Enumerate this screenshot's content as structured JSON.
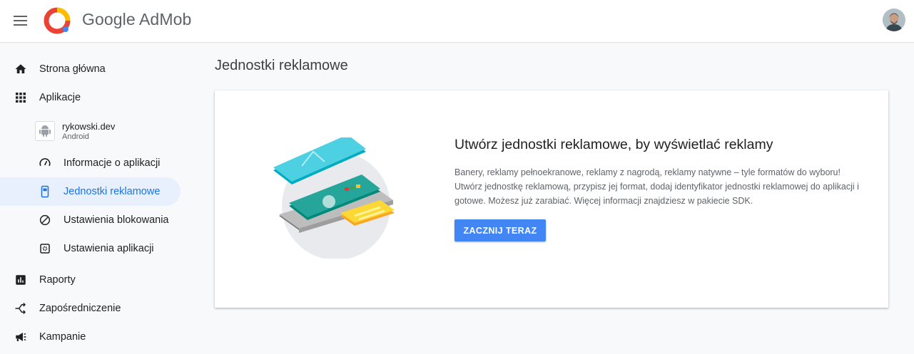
{
  "header": {
    "brand": "Google AdMob",
    "menu_icon": "hamburger-menu-icon",
    "logo_icon": "admob-logo-icon",
    "avatar_icon": "user-avatar"
  },
  "sidebar": {
    "items": [
      {
        "label": "Strona główna",
        "icon": "home-icon"
      },
      {
        "label": "Aplikacje",
        "icon": "apps-grid-icon"
      },
      {
        "label": "Informacje o aplikacji",
        "icon": "speedometer-icon"
      },
      {
        "label": "Jednostki reklamowe",
        "icon": "ad-unit-icon",
        "active": true
      },
      {
        "label": "Ustawienia blokowania",
        "icon": "block-icon"
      },
      {
        "label": "Ustawienia aplikacji",
        "icon": "app-settings-icon"
      },
      {
        "label": "Raporty",
        "icon": "bar-chart-icon"
      },
      {
        "label": "Zapośredniczenie",
        "icon": "mediation-icon"
      },
      {
        "label": "Kampanie",
        "icon": "megaphone-icon"
      }
    ],
    "app": {
      "name": "rykowski.dev",
      "platform": "Android",
      "icon": "android-icon"
    }
  },
  "main": {
    "page_title": "Jednostki reklamowe",
    "card": {
      "title": "Utwórz jednostki reklamowe, by wyświetlać reklamy",
      "description": "Banery, reklamy pełnoekranowe, reklamy z nagrodą, reklamy natywne – tyle formatów do wyboru! Utwórz jednostkę reklamową, przypisz jej format, dodaj identyfikator jednostki reklamowej do aplikacji i gotowe. Możesz już zarabiać. Więcej informacji znajdziesz w pakiecie SDK.",
      "button": "ZACZNIJ TERAZ",
      "illustration": "ad-formats-illustration"
    }
  },
  "colors": {
    "accent": "#1a73e8",
    "button": "#4285f4",
    "active_bg": "#e8f0fe"
  }
}
